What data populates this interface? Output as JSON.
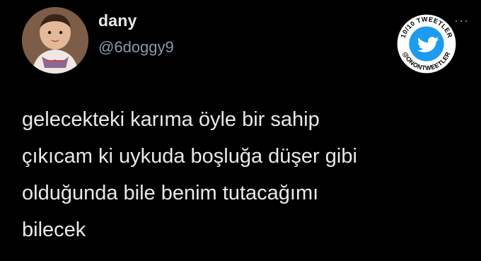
{
  "tweet": {
    "display_name": "dany",
    "handle": "@6doggy9",
    "text_lines": [
      "gelecekteki karıma öyle bir sahip",
      "çıkıcam ki uykuda boşluğa düşer gibi",
      "olduğunda bile benim tutacağımı",
      "bilecek"
    ],
    "more_glyph": "···"
  },
  "watermark": {
    "top_text": "10/10 TWEETLER",
    "bottom_text": "@ONONTWEETLER",
    "icon": "twitter-bird-icon",
    "color": "#1d9bf0"
  },
  "colors": {
    "background": "#000000",
    "text": "#e7e9ea",
    "secondary": "#8b98a5"
  }
}
